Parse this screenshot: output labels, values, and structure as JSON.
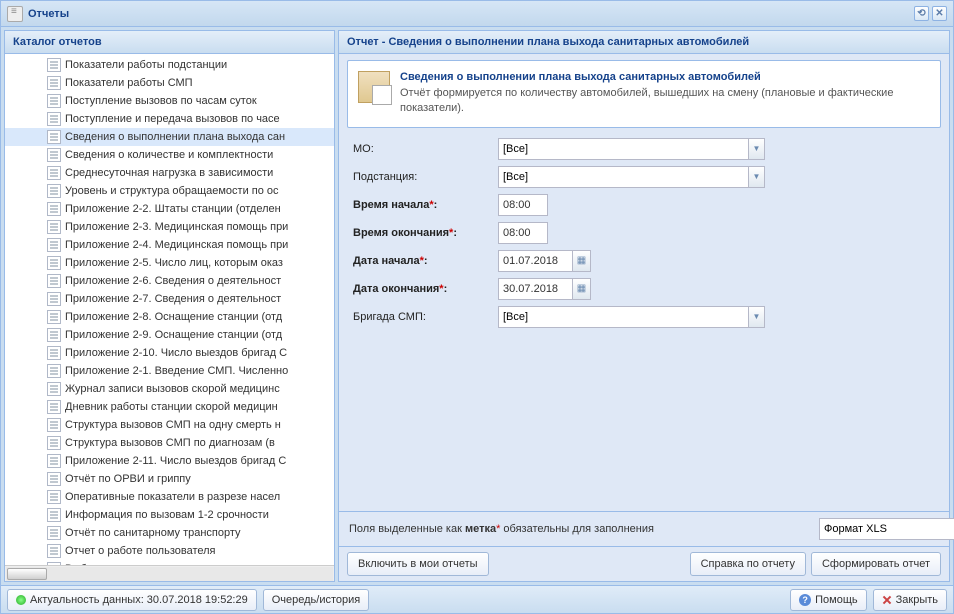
{
  "window": {
    "title": "Отчеты"
  },
  "catalog": {
    "header": "Каталог отчетов",
    "selected_index": 4,
    "items": [
      "Показатели работы подстанции",
      "Показатели работы СМП",
      "Поступление вызовов по часам суток",
      "Поступление и передача вызовов по часе",
      "Сведения о выполнении плана выхода сан",
      "Сведения о количестве и комплектности",
      "Среднесуточная нагрузка в зависимости",
      "Уровень и структура обращаемости по ос",
      "Приложение 2-2. Штаты станции (отделен",
      "Приложение 2-3. Медицинская помощь при",
      "Приложение 2-4. Медицинская помощь при",
      "Приложение 2-5. Число лиц, которым оказ",
      "Приложение 2-6. Сведения о деятельност",
      "Приложение 2-7. Сведения о деятельност",
      "Приложение 2-8. Оснащение станции (отд",
      "Приложение 2-9. Оснащение станции (отд",
      "Приложение 2-10. Число выездов бригад С",
      "Приложение 2-1. Введение СМП. Численно",
      "Журнал записи вызовов скорой медицинс",
      "Дневник работы станции скорой медицин",
      "Структура вызовов СМП на одну смерть н",
      "Структура вызовов СМП по диагнозам (в",
      "Приложение 2-11. Число выездов бригад С",
      "Отчёт по ОРВИ и гриппу",
      "Оперативные показатели в разрезе насел",
      "Информация по вызовам 1-2 срочности",
      "Отчёт по санитарному транспорту",
      "Отчет о работе пользователя",
      "Выборка по диагнозам и поводам"
    ]
  },
  "report": {
    "header": "Отчет - Сведения о выполнении плана выхода санитарных автомобилей",
    "desc_title": "Сведения о выполнении плана выхода санитарных автомобилей",
    "desc_body": "Отчёт формируется по количеству автомобилей, вышедших на смену (плановые и фактические показатели).",
    "fields": {
      "mo": {
        "label": "МО:",
        "value": "[Все]"
      },
      "substation": {
        "label": "Подстанция:",
        "value": "[Все]"
      },
      "time_start": {
        "label": "Время начала",
        "value": "08:00"
      },
      "time_end": {
        "label": "Время окончания",
        "value": "08:00"
      },
      "date_start": {
        "label": "Дата начала",
        "value": "01.07.2018"
      },
      "date_end": {
        "label": "Дата окончания",
        "value": "30.07.2018"
      },
      "brigade": {
        "label": "Бригада СМП:",
        "value": "[Все]"
      }
    },
    "hint_prefix": "Поля выделенные как ",
    "hint_bold": "метка",
    "hint_suffix": " обязательны для заполнения",
    "format": "Формат XLS",
    "buttons": {
      "include": "Включить в мои отчеты",
      "help": "Справка по отчету",
      "generate": "Сформировать отчет"
    }
  },
  "status": {
    "data": "Актуальность данных: 30.07.2018 19:52:29",
    "queue": "Очередь/история",
    "help": "Помощь",
    "close": "Закрыть"
  }
}
